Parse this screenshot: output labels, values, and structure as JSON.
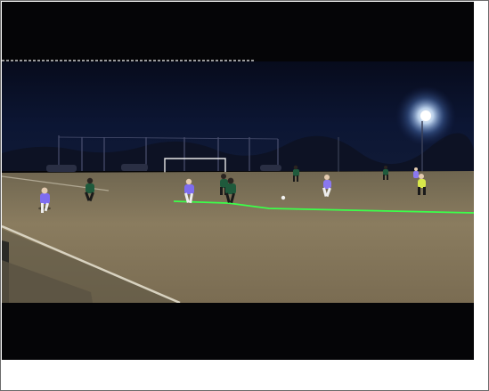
{
  "scene": {
    "description_tags": [
      "night-soccer-match",
      "floodlight",
      "offside-line"
    ],
    "colors": {
      "sky": "#0a1024",
      "pitch": "#8a7a5c",
      "offside_line": "#3cff4a",
      "team_purple": "#7e6cf0",
      "team_green": "#1f5a3c",
      "referee_yellow": "#d8e84a"
    }
  }
}
